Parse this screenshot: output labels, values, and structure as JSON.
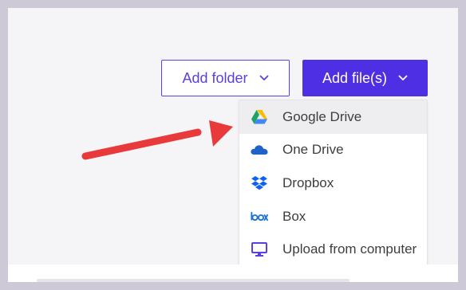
{
  "toolbar": {
    "add_folder_label": "Add folder",
    "add_files_label": "Add file(s)"
  },
  "dropdown": {
    "items": [
      {
        "label": "Google Drive",
        "icon": "google-drive-icon",
        "active": true
      },
      {
        "label": "One Drive",
        "icon": "onedrive-icon",
        "active": false
      },
      {
        "label": "Dropbox",
        "icon": "dropbox-icon",
        "active": false
      },
      {
        "label": "Box",
        "icon": "box-icon",
        "active": false
      },
      {
        "label": "Upload from computer",
        "icon": "monitor-icon",
        "active": false
      }
    ]
  },
  "colors": {
    "accent": "#4f2fe3",
    "annotation_arrow": "#e83a3a",
    "frame": "#cdc9d6",
    "panel": "#f5f5f7"
  }
}
